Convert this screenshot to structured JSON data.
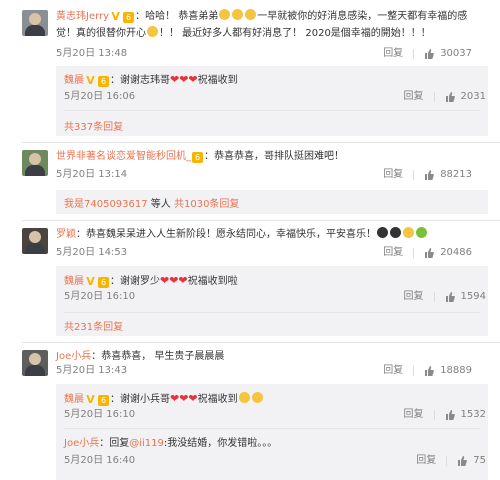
{
  "comments": [
    {
      "user": "黄志玮Jerry",
      "text_lines": [
        "：哈哈！ 恭喜弟弟",
        "一早就被你的好消息感染，一整天都有幸福的感",
        "觉！真的很替你开心",
        "！！ 最近好多人都有好消息了！ 2020是個幸福的開始！！！"
      ],
      "date": "5月20日 13:48",
      "reply_label": "回复",
      "likes": "30037",
      "replies": [
        {
          "user": "魏晨",
          "text": "：谢谢志玮哥",
          "tail": "祝福收到",
          "date": "5月20日 16:06",
          "reply_label": "回复",
          "likes": "2031"
        }
      ],
      "more": "共337条回复"
    },
    {
      "user": "世界非著名谈恋爱智能秒回机_",
      "text": "：恭喜恭喜，哥排队挺困难吧！",
      "date": "5月20日 13:14",
      "reply_label": "回复",
      "likes": "88213",
      "replies_line": {
        "user": "我是7405093617",
        "text": " 等人 ",
        "more": "共1030条回复"
      }
    },
    {
      "user": "罗颖",
      "text": "：恭喜魏呆呆进入人生新阶段！愿永结同心，幸福快乐，平安喜乐！",
      "date": "5月20日 14:53",
      "reply_label": "回复",
      "likes": "20486",
      "replies": [
        {
          "user": "魏晨",
          "text": "：谢谢罗少",
          "tail": "祝福收到啦",
          "date": "5月20日 16:10",
          "reply_label": "回复",
          "likes": "1594"
        }
      ],
      "more": "共231条回复"
    },
    {
      "user": "Joe小兵",
      "text": "：恭喜恭喜， 早生贵子晨晨晨",
      "date": "5月20日 13:43",
      "reply_label": "回复",
      "likes": "18889",
      "replies": [
        {
          "user": "魏晨",
          "text": "：谢谢小兵哥",
          "tail": "祝福收到",
          "date": "5月20日 16:10",
          "reply_label": "回复",
          "likes": "1532"
        },
        {
          "user": "Joe小兵",
          "text": "：回复",
          "mention": "@ii119",
          "tail": ":我没结婚，你发错啦。。。",
          "date": "5月20日 16:40",
          "reply_label": "回复",
          "likes": "75"
        }
      ]
    }
  ],
  "colors": {
    "username": "#eb7350",
    "heart": "#e8333c",
    "reply_bg": "#f2f2f5",
    "meta": "#808080"
  }
}
